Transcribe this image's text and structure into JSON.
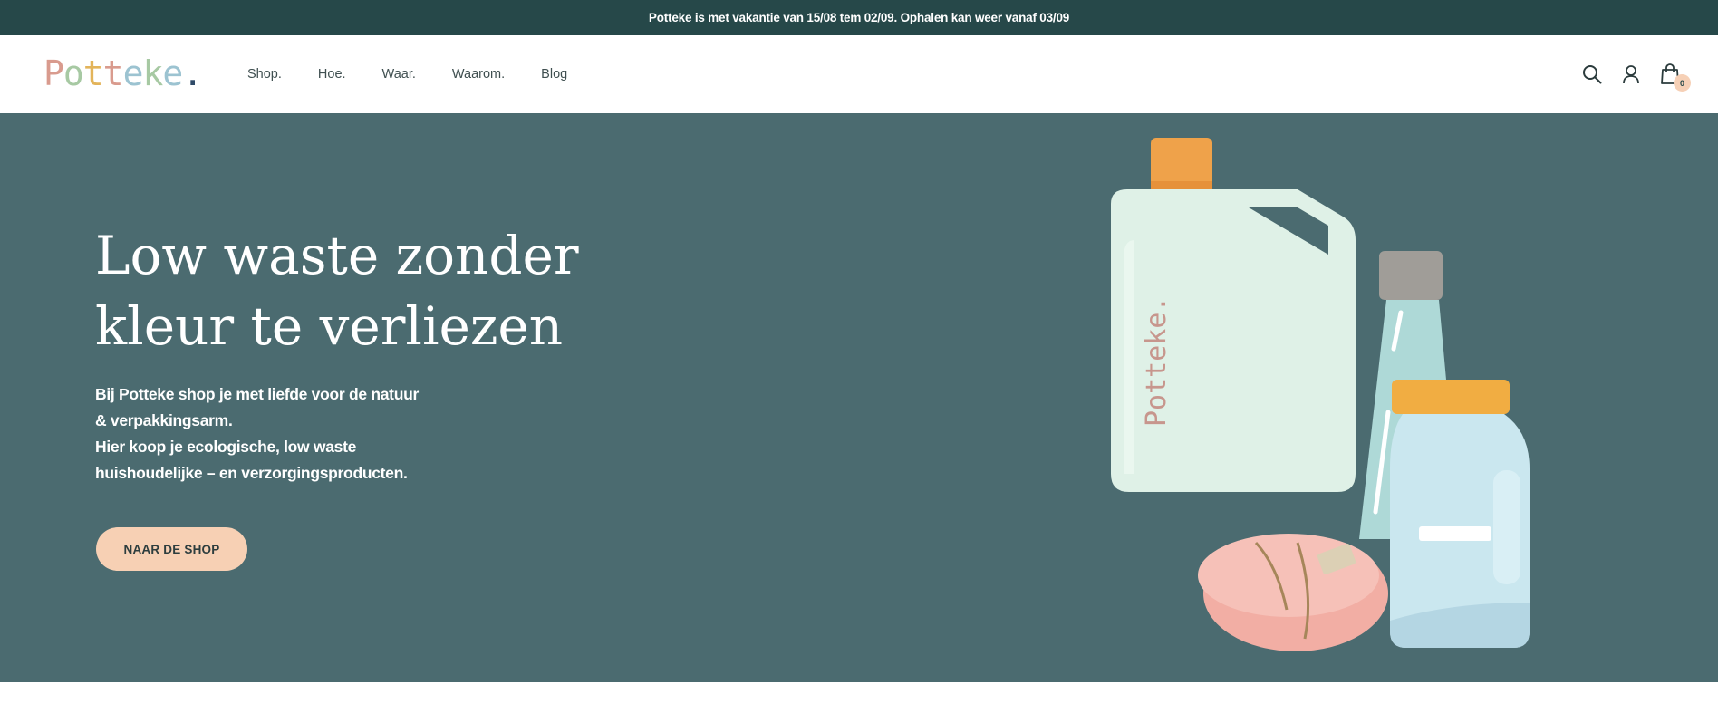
{
  "announcement": "Potteke is met vakantie van 15/08 tem 02/09. Ophalen kan weer vanaf 03/09",
  "logo": {
    "text": "Potteke.",
    "letters": [
      {
        "ch": "P",
        "color": "#d99b8e"
      },
      {
        "ch": "o",
        "color": "#a7c9a3"
      },
      {
        "ch": "t",
        "color": "#e3b45a"
      },
      {
        "ch": "t",
        "color": "#d99b8e"
      },
      {
        "ch": "e",
        "color": "#9cc3d1"
      },
      {
        "ch": "k",
        "color": "#a7c9a3"
      },
      {
        "ch": "e",
        "color": "#9cc3d1"
      },
      {
        "ch": ".",
        "color": "#2f4a68"
      }
    ]
  },
  "nav": {
    "items": [
      "Shop.",
      "Hoe.",
      "Waar.",
      "Waarom.",
      "Blog"
    ]
  },
  "header_icons": {
    "search": "search-icon",
    "account": "user-icon",
    "cart": "shopping-bag-icon",
    "cart_count": "0"
  },
  "hero": {
    "title_line1": "Low waste zonder",
    "title_line2": "kleur te verliezen",
    "text_line1": "Bij Potteke shop je met liefde voor de natuur",
    "text_line2": "& verpakkingsarm.",
    "text_line3": "Hier koop je ecologische, low waste",
    "text_line4": "huishoudelijke – en verzorgingsproducten.",
    "cta": "NAAR DE SHOP",
    "canister_label": "Potteke.",
    "colors": {
      "background": "#4b6b70",
      "cta": "#f7d0b4",
      "announcement_bar": "#264849"
    }
  }
}
